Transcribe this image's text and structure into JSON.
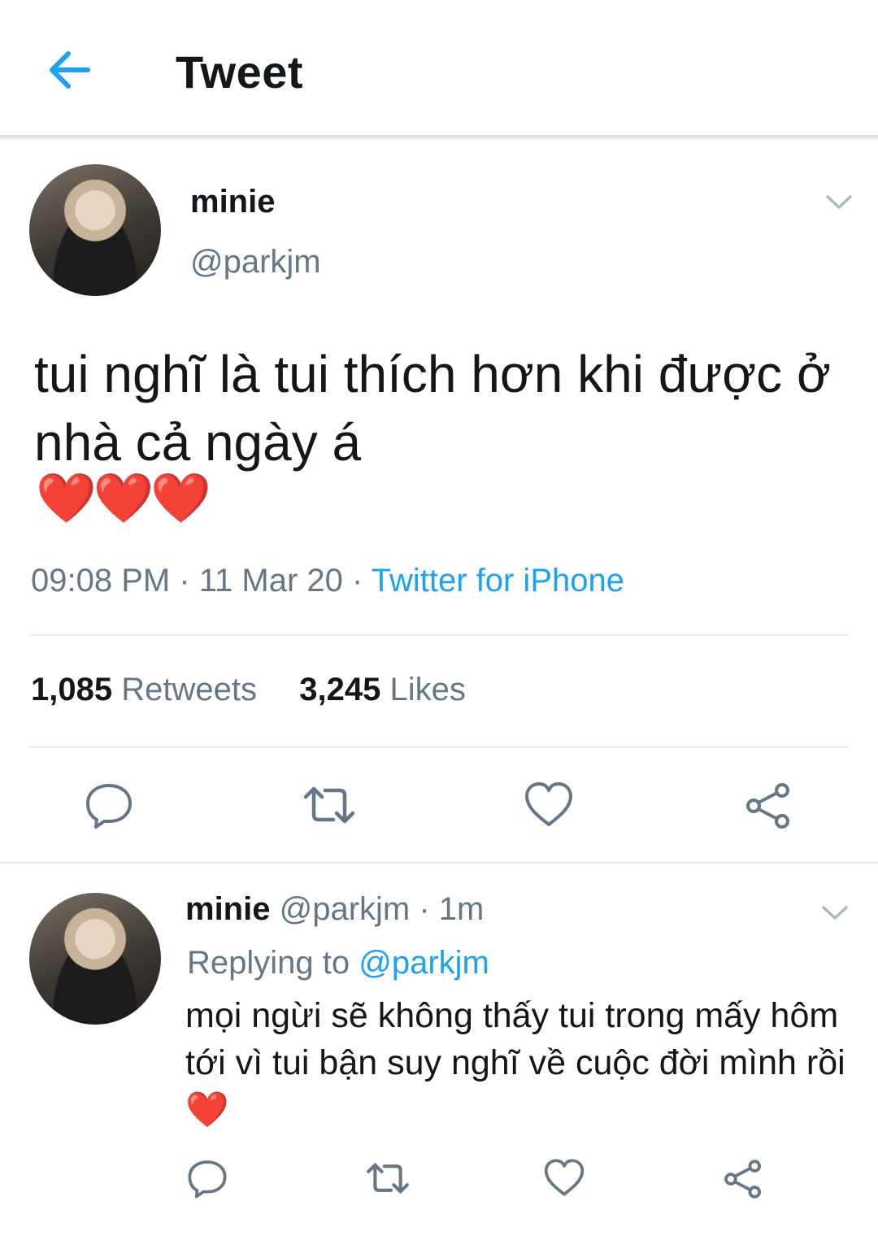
{
  "header": {
    "title": "Tweet"
  },
  "tweet": {
    "display_name": "minie",
    "handle": "@parkjm",
    "text": "tui nghĩ là tui thích hơn khi được ở nhà cả ngày á",
    "emoji": "❤️❤️❤️",
    "time": "09:08 PM",
    "separator": " · ",
    "date": "11 Mar 20",
    "source": "Twitter for iPhone",
    "retweets_count": "1,085",
    "retweets_label": "Retweets",
    "likes_count": "3,245",
    "likes_label": "Likes"
  },
  "reply": {
    "display_name": "minie",
    "handle": "@parkjm",
    "age": "1m",
    "separator": " · ",
    "replying_prefix": "Replying to",
    "replying_to": "@parkjm",
    "text": "mọi ngừi sẽ không thấy tui trong mấy hôm tới vì tui bận suy nghĩ về cuộc đời mình rồi",
    "emoji": "❤️"
  },
  "icons": {
    "back": "arrow-left-icon",
    "chevron": "chevron-down-icon",
    "reply": "reply-bubble-icon",
    "retweet": "retweet-icon",
    "like": "heart-outline-icon",
    "share": "share-icon"
  },
  "colors": {
    "accent": "#1da1f2",
    "text": "#14171a",
    "secondary": "#657786",
    "icon": "#657786"
  }
}
